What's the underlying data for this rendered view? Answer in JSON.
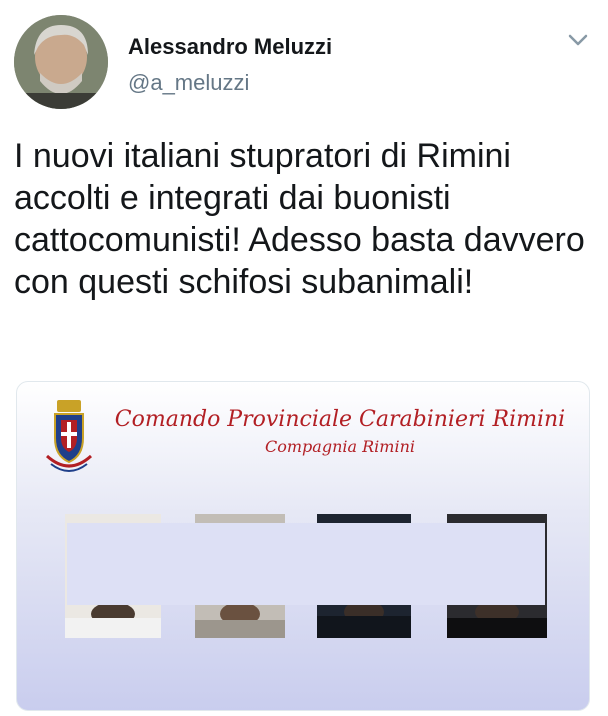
{
  "tweet": {
    "author_name": "Alessandro Meluzzi",
    "author_handle": "@a_meluzzi",
    "menu_icon": "chevron-down-icon",
    "text": "I nuovi italiani stupratori di Rimini accolti e integrati dai buonisti cattocomunisti! Adesso basta davvero con questi schifosi subanimali!"
  },
  "media": {
    "title": "Comando Provinciale Carabinieri Rimini",
    "subtitle": "Compagnia Rimini",
    "crest_icon": "carabinieri-crest-icon"
  },
  "colors": {
    "name": "#14171a",
    "handle": "#657786",
    "media_title": "#b21f24"
  }
}
